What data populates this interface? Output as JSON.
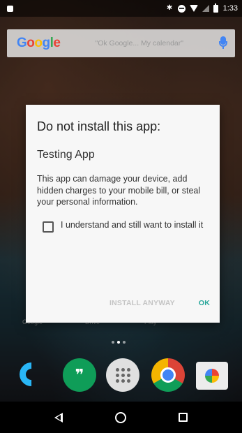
{
  "status_bar": {
    "time": "1:33"
  },
  "search": {
    "logo": [
      "G",
      "o",
      "o",
      "g",
      "l",
      "e"
    ],
    "hint": "\"Ok Google... My calendar\""
  },
  "home_labels": [
    "Google",
    "Drive",
    "Play"
  ],
  "dialog": {
    "title": "Do not install this app:",
    "app_name": "Testing App",
    "warning": "This app can damage your device, add hidden charges to your mobile bill, or steal your personal information.",
    "checkbox_label": "I understand and still want to install it",
    "checkbox_checked": false,
    "install_anyway_label": "INSTALL ANYWAY",
    "ok_label": "OK"
  },
  "dock": {
    "apps": [
      "phone-icon",
      "hangouts-icon",
      "apps-icon",
      "chrome-icon",
      "photos-icon"
    ],
    "hangouts_glyph": "❞"
  },
  "colors": {
    "ok_accent": "#26a69a",
    "install_disabled": "#c4c4c4",
    "dialog_bg": "#f7f7f7"
  }
}
